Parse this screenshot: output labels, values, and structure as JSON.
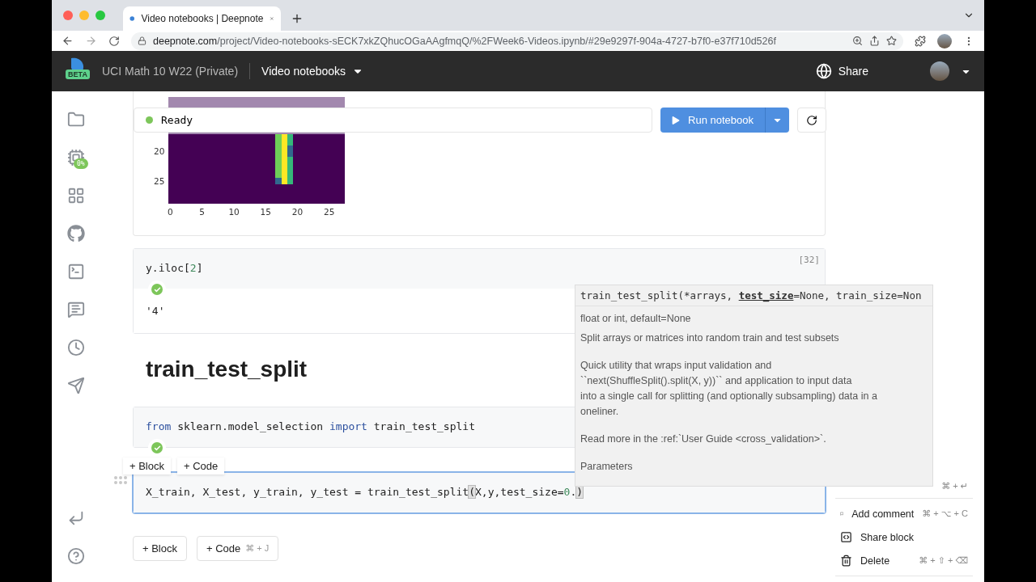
{
  "browser": {
    "tab_title": "Video notebooks | Deepnote",
    "url_host": "deepnote.com",
    "url_path": "/project/Video-notebooks-sECK7xkZQhucOGaAAgfmqQ/%2FWeek6-Videos.ipynb/#29e9297f-904a-4727-b7f0-e37f710d526f"
  },
  "header": {
    "logo_badge": "BETA",
    "workspace": "UCI Math 10 W22 (Private)",
    "project": "Video notebooks",
    "share": "Share"
  },
  "sidebar": {
    "usage_badge": "0%"
  },
  "toolbar": {
    "status": "Ready",
    "run_button": "Run notebook"
  },
  "plot": {
    "yticks": [
      "20",
      "25"
    ],
    "xticks": [
      "0",
      "5",
      "10",
      "15",
      "20",
      "25"
    ]
  },
  "cells": [
    {
      "kind": "code",
      "selected": false,
      "execution_count": "[32]",
      "lines": [
        [
          {
            "text": "y.iloc[",
            "kind": "plain"
          },
          {
            "text": "2",
            "kind": "number"
          },
          {
            "text": "]",
            "kind": "plain"
          }
        ]
      ],
      "output": "'4'"
    },
    {
      "kind": "heading",
      "text": "train_test_split"
    },
    {
      "kind": "code",
      "selected": false,
      "lines": [
        [
          {
            "text": "from",
            "kind": "keyword"
          },
          {
            "text": " sklearn.model_selection ",
            "kind": "plain"
          },
          {
            "text": "import",
            "kind": "keyword"
          },
          {
            "text": " train_test_split",
            "kind": "plain"
          }
        ]
      ]
    },
    {
      "kind": "code",
      "selected": true,
      "lines": [
        [
          {
            "text": "X_train, X_test, y_train, y_test = train_test_split",
            "kind": "plain"
          },
          {
            "text": "(",
            "kind": "bracket"
          },
          {
            "text": "X,y,test_size=",
            "kind": "plain"
          },
          {
            "text": "0",
            "kind": "number"
          },
          {
            "text": ".",
            "kind": "plain"
          },
          {
            "text": ")",
            "kind": "bracket"
          }
        ]
      ]
    }
  ],
  "insert_buttons": [
    {
      "label": "+ Block"
    },
    {
      "label": "+ Code"
    }
  ],
  "bottom_buttons": [
    {
      "label": "+ Block"
    },
    {
      "label": "+ Code",
      "shortcut": "⌘ + J"
    }
  ],
  "tooltip": {
    "signature": "train_test_split(*arrays, **test_size**=None, train_size=Non",
    "paragraphs": [
      [
        "float or int, default=None"
      ],
      [
        "Split arrays or matrices into random train and test subsets"
      ],
      [
        "Quick utility that wraps input validation and",
        "``next(ShuffleSplit().split(X, y))`` and application to input data",
        "into a single call for splitting (and optionally subsampling) data in a",
        "oneliner."
      ],
      [
        "Read more in the :ref:`User Guide <cross_validation>`."
      ],
      [
        "Parameters"
      ]
    ]
  },
  "block_menu": [
    {
      "kind": "run",
      "shortcut": "⌘ + ↵"
    },
    {
      "kind": "comment",
      "label": "Add comment",
      "shortcut": "⌘ + ⌥ + C"
    },
    {
      "kind": "share",
      "label": "Share block"
    },
    {
      "kind": "delete",
      "label": "Delete",
      "shortcut": "⌘ + ⇧ + ⌫"
    }
  ]
}
